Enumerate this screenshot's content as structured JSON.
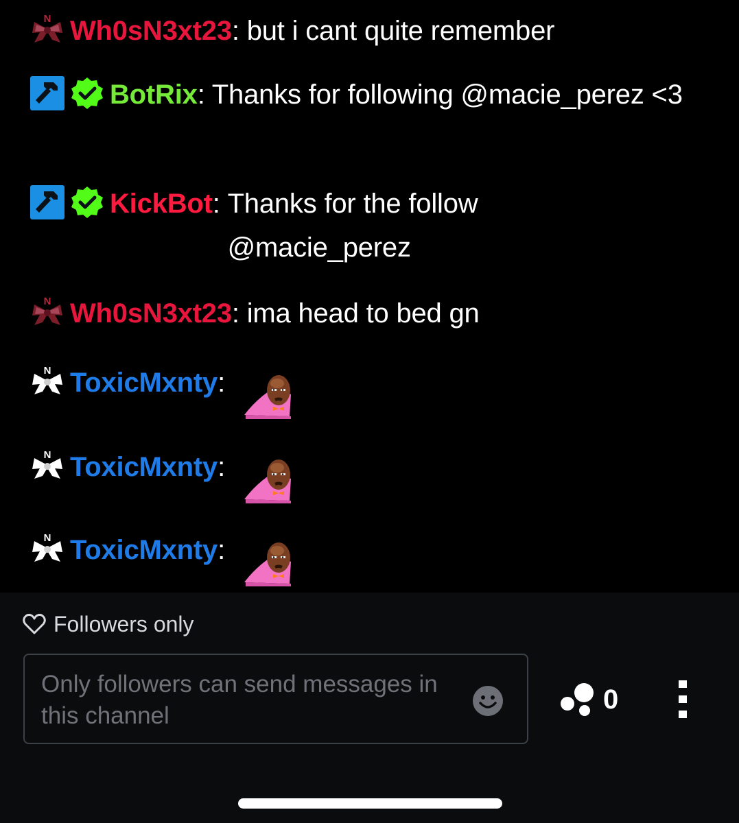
{
  "chat": {
    "messages": [
      {
        "badges": [
          "gifter-bow-badge-red"
        ],
        "username": "Wh0sN3xt23",
        "separator": ": ",
        "text": "but i cant quite remember",
        "color": "#e8163c"
      },
      {
        "badges": [
          "moderator-hammer-badge",
          "verified-badge"
        ],
        "username": "BotRix",
        "separator": ": ",
        "text": "Thanks for following @macie_perez <3",
        "color": "#75ea39"
      },
      {
        "badges": [
          "moderator-hammer-badge",
          "verified-badge"
        ],
        "username": "KickBot",
        "separator": ": ",
        "text": "Thanks for the follow @macie_perez",
        "color": "#ff1a40"
      },
      {
        "badges": [
          "gifter-bow-badge-red"
        ],
        "username": "Wh0sN3xt23",
        "separator": ": ",
        "text": "ima head to bed gn",
        "color": "#e8163c"
      },
      {
        "badges": [
          "gifter-bow-badge-white"
        ],
        "username": "ToxicMxnty",
        "separator": ":",
        "emote": "bald-man-blanket-emote",
        "color": "#1f7be8"
      },
      {
        "badges": [
          "gifter-bow-badge-white"
        ],
        "username": "ToxicMxnty",
        "separator": ":",
        "emote": "bald-man-blanket-emote",
        "color": "#1f7be8"
      },
      {
        "badges": [
          "gifter-bow-badge-white"
        ],
        "username": "ToxicMxnty",
        "separator": ":",
        "emote": "bald-man-blanket-emote",
        "color": "#1f7be8"
      }
    ]
  },
  "footer": {
    "mode_icon": "heart-outline-icon",
    "mode_label": "Followers only",
    "input_placeholder": "Only followers can send messages in this channel",
    "emoji_icon": "smiley-face-icon",
    "viewers_icon": "bubbles-icon",
    "viewers_count": "0",
    "more_icon": "vertical-dots-icon"
  },
  "colors": {
    "background": "#000000",
    "footer_background": "#0b0c0e",
    "input_border": "#3c4148",
    "placeholder": "#6f7379"
  }
}
